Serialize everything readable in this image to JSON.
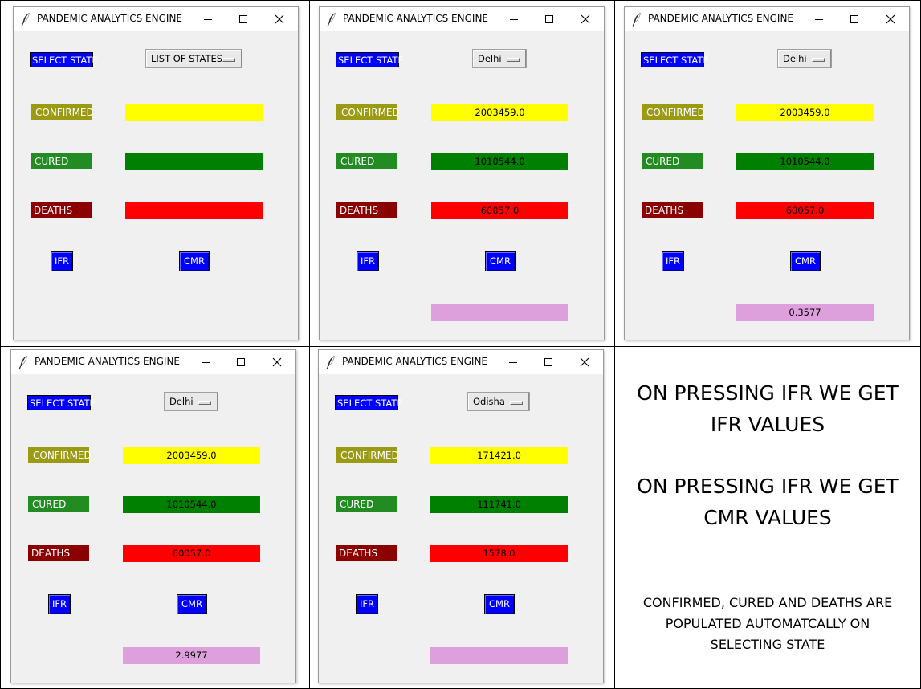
{
  "windows": [
    {
      "title": "PANDEMIC ANALYTICS ENGINE",
      "select_state_label": "SELECT STATE",
      "dropdown_value": "LIST OF STATES",
      "confirmed_label": "CONFIRMED",
      "cured_label": "CURED",
      "deaths_label": "DEATHS",
      "confirmed_value": "",
      "cured_value": "",
      "deaths_value": "",
      "ifr_label": "IFR",
      "cmr_label": "CMR",
      "result_value": "",
      "has_result_field": false
    },
    {
      "title": "PANDEMIC ANALYTICS ENGINE",
      "select_state_label": "SELECT STATE",
      "dropdown_value": "Delhi",
      "confirmed_label": "CONFIRMED",
      "cured_label": "CURED",
      "deaths_label": "DEATHS",
      "confirmed_value": "2003459.0",
      "cured_value": "1010544.0",
      "deaths_value": "60057.0",
      "ifr_label": "IFR",
      "cmr_label": "CMR",
      "result_value": "",
      "has_result_field": true
    },
    {
      "title": "PANDEMIC ANALYTICS ENGINE",
      "select_state_label": "SELECT STATE",
      "dropdown_value": "Delhi",
      "confirmed_label": "CONFIRMED",
      "cured_label": "CURED",
      "deaths_label": "DEATHS",
      "confirmed_value": "2003459.0",
      "cured_value": "1010544.0",
      "deaths_value": "60057.0",
      "ifr_label": "IFR",
      "cmr_label": "CMR",
      "result_value": "0.3577",
      "has_result_field": true
    },
    {
      "title": "PANDEMIC ANALYTICS ENGINE",
      "select_state_label": "SELECT STATE",
      "dropdown_value": "Delhi",
      "confirmed_label": "CONFIRMED",
      "cured_label": "CURED",
      "deaths_label": "DEATHS",
      "confirmed_value": "2003459.0",
      "cured_value": "1010544.0",
      "deaths_value": "60057.0",
      "ifr_label": "IFR",
      "cmr_label": "CMR",
      "result_value": "2.9977",
      "has_result_field": true
    },
    {
      "title": "PANDEMIC ANALYTICS ENGINE",
      "select_state_label": "SELECT STATE",
      "dropdown_value": "Odisha",
      "confirmed_label": "CONFIRMED",
      "cured_label": "CURED",
      "deaths_label": "DEATHS",
      "confirmed_value": "171421.0",
      "cured_value": "111741.0",
      "deaths_value": "1578.0",
      "ifr_label": "IFR",
      "cmr_label": "CMR",
      "result_value": "",
      "has_result_field": true
    }
  ],
  "notes": {
    "line1": "ON PRESSING IFR WE GET",
    "line2": "IFR VALUES",
    "line3": "ON PRESSING IFR WE GET",
    "line4": "CMR VALUES",
    "caption1": "CONFIRMED, CURED AND DEATHS ARE",
    "caption2": "POPULATED AUTOMATCALLY ON",
    "caption3": "SELECTING STATE"
  },
  "colors": {
    "select_state": "#0000ff",
    "confirmed_label": "#9a9a13",
    "cured_label": "#228b22",
    "deaths_label": "#8b0000",
    "confirmed_field": "#ffff00",
    "cured_field": "#008000",
    "deaths_field": "#ff0000",
    "result_field": "#dda0dd",
    "buttons": "#0000ff"
  },
  "icons": [
    "feather-icon",
    "minimize-icon",
    "maximize-icon",
    "close-icon"
  ]
}
